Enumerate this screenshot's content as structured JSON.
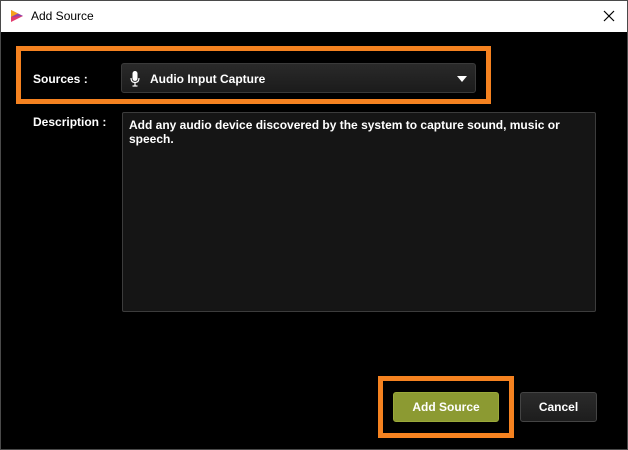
{
  "window": {
    "title": "Add Source",
    "close_icon": "close-icon",
    "app_icon": "app-logo-icon"
  },
  "form": {
    "sources_label": "Sources :",
    "sources_selected": "Audio Input Capture",
    "sources_icon": "microphone-icon",
    "description_label": "Description :",
    "description_text": "Add any audio device discovered by the system to capture sound, music or speech."
  },
  "buttons": {
    "add_label": "Add Source",
    "cancel_label": "Cancel"
  },
  "colors": {
    "highlight": "#f58220",
    "add_button": "#8c9a32",
    "background": "#000000",
    "field": "#151515"
  }
}
